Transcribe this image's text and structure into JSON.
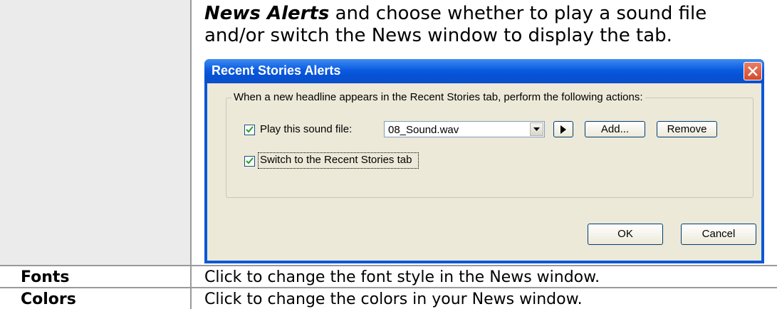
{
  "intro": {
    "bold": "News Alerts",
    "text": " and choose whether to play a sound file and/or switch the News window to display the tab."
  },
  "dialog": {
    "title": "Recent Stories Alerts",
    "group_label": "When a new headline appears in the Recent Stories tab, perform the following actions:",
    "play_sound_label": "Play this sound file:",
    "play_sound_checked": true,
    "sound_file_value": "08_Sound.wav",
    "add_button": "Add...",
    "remove_button": "Remove",
    "switch_label": "Switch to the Recent Stories tab",
    "switch_checked": true,
    "ok_button": "OK",
    "cancel_button": "Cancel"
  },
  "rows": [
    {
      "label": "Fonts",
      "description": "Click to change the font style in the News window."
    },
    {
      "label": "Colors",
      "description": "Click to change the colors in your News window."
    }
  ],
  "colors": {
    "titlebar": "#0b5be0",
    "dialog_body": "#ece9d8",
    "close_button": "#d34a2c",
    "left_cell": "#ebebeb"
  }
}
